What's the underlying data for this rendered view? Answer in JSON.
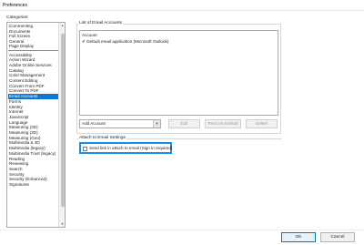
{
  "window": {
    "title": "Preferences"
  },
  "categories": {
    "label": "Categories:",
    "top_items": [
      "Commenting",
      "Documents",
      "Full Screen",
      "General",
      "Page Display"
    ],
    "items": [
      "Accessibility",
      "Action Wizard",
      "Adobe Online Services",
      "Catalog",
      "Color Management",
      "Content Editing",
      "Convert From PDF",
      "Convert To PDF",
      "Email Accounts",
      "Forms",
      "Identity",
      "Internet",
      "JavaScript",
      "Language",
      "Measuring (2D)",
      "Measuring (3D)",
      "Measuring (Geo)",
      "Multimedia & 3D",
      "Multimedia (legacy)",
      "Multimedia Trust (legacy)",
      "Reading",
      "Reviewing",
      "Search",
      "Security",
      "Security (Enhanced)",
      "Signatures"
    ],
    "selected": "Email Accounts"
  },
  "email_accounts": {
    "group_label": "List of Email Accounts",
    "column_header": "Account",
    "accounts": [
      {
        "checked": true,
        "name": "Default email application (Microsoft Outlook)"
      }
    ],
    "add_account": "Add Account",
    "edit": "Edit",
    "remove_default": "Remove Default",
    "delete": "Delete"
  },
  "attach_settings": {
    "group_label": "Attach to Email Settings",
    "send_link_label": "Send link in attach to email (Sign in required)",
    "send_link_checked": false
  },
  "footer": {
    "ok": "OK",
    "cancel": "Cancel"
  }
}
